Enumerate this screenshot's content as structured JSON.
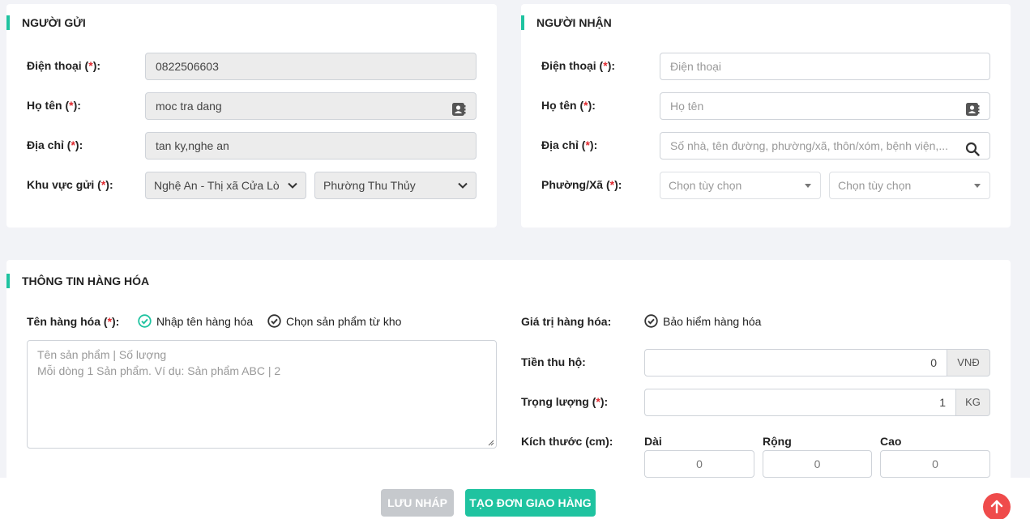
{
  "sender": {
    "title": "NGƯỜI GỬI",
    "phone": {
      "label": "Điện thoại (",
      "req": "*",
      "suffix": "):",
      "value": "0822506603"
    },
    "name": {
      "label": "Họ tên (",
      "req": "*",
      "suffix": "):",
      "value": "moc tra dang"
    },
    "address": {
      "label": "Địa chỉ (",
      "req": "*",
      "suffix": "):",
      "value": "tan ky,nghe an"
    },
    "region": {
      "label": "Khu vực gửi (",
      "req": "*",
      "suffix": "):",
      "province": "Nghệ An - Thị xã Cửa Lò",
      "ward": "Phường Thu Thủy"
    }
  },
  "receiver": {
    "title": "NGƯỜI NHẬN",
    "phone": {
      "label": "Điện thoại (",
      "req": "*",
      "suffix": "):",
      "placeholder": "Điện thoại"
    },
    "name": {
      "label": "Họ tên (",
      "req": "*",
      "suffix": "):",
      "placeholder": "Họ tên"
    },
    "address": {
      "label": "Địa chỉ (",
      "req": "*",
      "suffix": "):",
      "placeholder": "Số nhà, tên đường, phường/xã, thôn/xóm, bệnh viện,..."
    },
    "ward": {
      "label": "Phường/Xã (",
      "req": "*",
      "suffix": "):",
      "placeholder1": "Chọn tùy chọn",
      "placeholder2": "Chọn tùy chọn"
    }
  },
  "goods": {
    "title": "THÔNG TIN HÀNG HÓA",
    "name_label": "Tên hàng hóa (",
    "name_req": "*",
    "name_suffix": "):",
    "option_manual": "Nhập tên hàng hóa",
    "option_stock": "Chọn sản phẩm từ kho",
    "textarea_line1": "Tên sản phẩm | Số lượng",
    "textarea_line2": "Mỗi dòng 1 Sản phẩm. Ví dụ: Sản phẩm ABC | 2",
    "value_label": "Giá trị hàng hóa:",
    "insurance": "Bảo hiểm hàng hóa",
    "cod_label": "Tiền thu hộ:",
    "cod_value": "0",
    "cod_unit": "VNĐ",
    "weight_label": "Trọng lượng (",
    "weight_req": "*",
    "weight_suffix": "):",
    "weight_value": "1",
    "weight_unit": "KG",
    "size_label": "Kích thước (cm):",
    "length_label": "Dài",
    "width_label": "Rộng",
    "height_label": "Cao",
    "length_value": "0",
    "width_value": "0",
    "height_value": "0"
  },
  "footer": {
    "draft_label": "LƯU NHÁP",
    "create_label": "TẠO ĐƠN GIAO HÀNG"
  },
  "colors": {
    "accent": "#1fc3a0",
    "required": "#e0282e",
    "scroll_top": "#ef4b4b"
  },
  "icons": [
    "contact-book-icon",
    "search-icon",
    "chevron-down-icon",
    "check-circle-icon",
    "arrow-up-icon"
  ]
}
